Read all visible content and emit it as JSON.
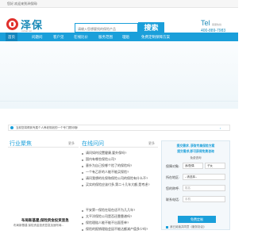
{
  "topbar": {
    "welcome": "您好,欢迎来到泽保网!"
  },
  "logo": {
    "name": "泽保",
    "sub": "zebao.net"
  },
  "search": {
    "placeholder": "请输入您想要找的保险产品",
    "button": "搜索"
  },
  "contact": {
    "tel_label": "Tel",
    "tel_sub": "客服热线",
    "tel_number": "400-889-7983"
  },
  "nav": {
    "items": [
      {
        "label": "首页"
      },
      {
        "label": "问题问"
      },
      {
        "label": "客户见"
      },
      {
        "label": "在线比价"
      },
      {
        "label": "服务范围"
      },
      {
        "label": "理赔"
      },
      {
        "label": "免费定制保障方案"
      }
    ]
  },
  "notice": {
    "text": "当前您将得到专属个人养老规划的一个专门顾问哦!"
  },
  "industry": {
    "title": "行业聚焦",
    "more": "更多",
    "news_title": "布局新基建,保险资金投资显急",
    "news_desc": "布局新基建,保险资金投资显急加速布局..."
  },
  "qa": {
    "title": "在线问问",
    "more": "更多",
    "items": [
      "请问如何设置健康,要外保吗?",
      "国内有哪些保险公司?",
      "意外为自己投哪个险了的保险吗?",
      "一个有乙肝的人能不能买保险?",
      "请问我想的社保和保险公司的保险有什么不?",
      "买实的保险应该付多,第二十几年大额,是考虑?",
      "平安第一保险在现在适不为几几年?",
      "太平洋保险公司是否还靠靠谱吗?",
      "保险理赔人能不能不出面签单?",
      "保险的报销理赔会因不能达额减产值多少吗?"
    ]
  },
  "form": {
    "title1": "提交需求, 获取专属保险方案",
    "title2": "提交需求,即可获得免费咨询",
    "subtitle": "免费咨询",
    "who_label": "保障对象:",
    "who_options": [
      "我/配偶",
      "子女"
    ],
    "region_label": "所在地区:",
    "region_value": "--请选择--",
    "name_label": "您的称呼:",
    "name_placeholder": "姓名",
    "phone_label": "联系电话:",
    "phone_placeholder": "手机",
    "submit": "免费定制",
    "agree": "我已阅读并同意《服务协议》"
  }
}
